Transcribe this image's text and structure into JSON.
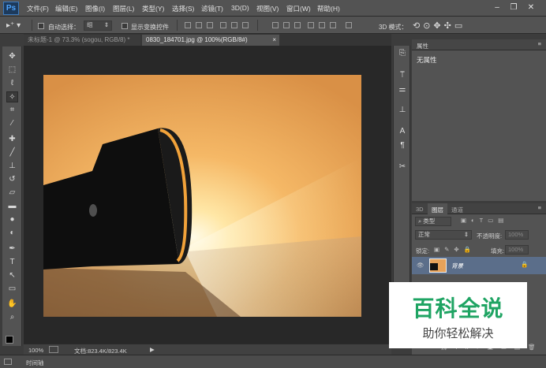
{
  "app": {
    "logo": "Ps"
  },
  "menu": [
    "文件(F)",
    "编辑(E)",
    "图像(I)",
    "图层(L)",
    "类型(Y)",
    "选择(S)",
    "滤镜(T)",
    "3D(D)",
    "视图(V)",
    "窗口(W)",
    "帮助(H)"
  ],
  "window_controls": {
    "minimize": "–",
    "restore": "❐",
    "close": "✕"
  },
  "options": {
    "auto_select_label": "自动选择：",
    "auto_select_value": "组",
    "show_transform_label": "显示变换控件",
    "mode3d_label": "3D 模式："
  },
  "tabs": [
    {
      "label": "未标题-1 @ 73.3% (sogou, RGB/8) *",
      "active": false
    },
    {
      "label": "0830_184701.jpg @ 100%(RGB/8#)",
      "active": true
    }
  ],
  "tools": [
    "move-icon",
    "marquee-icon",
    "lasso-icon",
    "magic-wand-icon",
    "crop-icon",
    "eyedropper-icon",
    "healing-brush-icon",
    "brush-icon",
    "clone-stamp-icon",
    "history-brush-icon",
    "eraser-icon",
    "gradient-icon",
    "blur-icon",
    "dodge-icon",
    "pen-icon",
    "type-icon",
    "path-select-icon",
    "rectangle-icon",
    "hand-icon",
    "zoom-icon"
  ],
  "statusbar": {
    "zoom": "100%",
    "doc": "文档:823.4K/823.4K"
  },
  "timeline": {
    "label": "时间轴"
  },
  "properties": {
    "tab": "属性",
    "text": "无属性"
  },
  "layers": {
    "tabs": [
      "3D",
      "图层",
      "通道"
    ],
    "filter_kind": "类型",
    "blend_mode": "正常",
    "opacity_label": "不透明度:",
    "opacity_value": "100%",
    "lock_label": "锁定:",
    "fill_label": "填充:",
    "fill_value": "100%",
    "layer_name": "背景"
  },
  "watermark": {
    "title": "百科全说",
    "subtitle": "助你轻松解决"
  },
  "colors": {
    "accent": "#4fa6ff",
    "watermark_green": "#1fa463",
    "selected_layer": "#5b6e8a"
  }
}
